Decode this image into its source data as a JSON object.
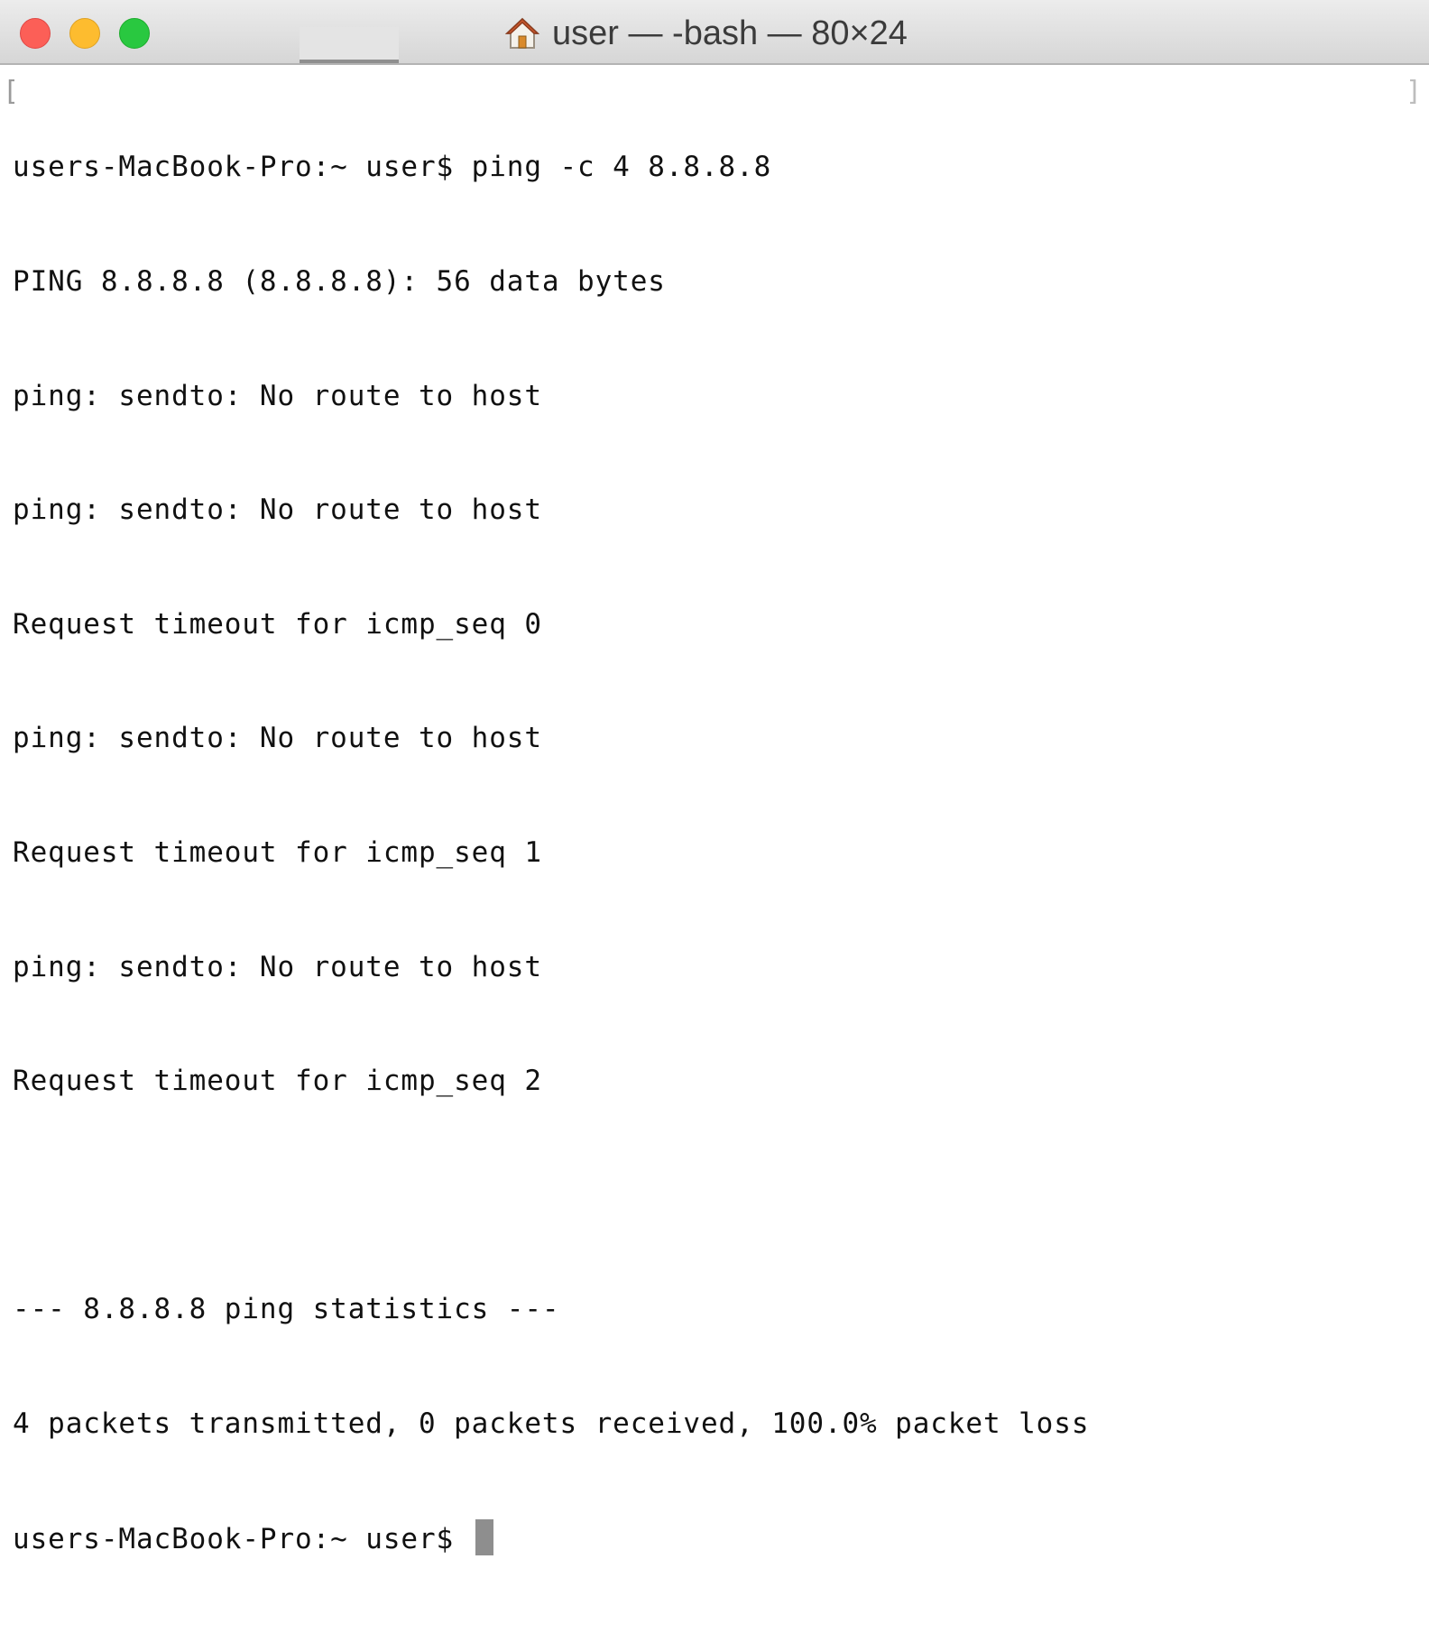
{
  "window": {
    "title": "user — -bash — 80×24",
    "traffic_lights": [
      "close",
      "minimize",
      "zoom"
    ],
    "colors": {
      "close": "#fc5f57",
      "minimize": "#fdbc2f",
      "zoom": "#29c840"
    }
  },
  "terminal": {
    "lines": [
      "users-MacBook-Pro:~ user$ ping -c 4 8.8.8.8",
      "PING 8.8.8.8 (8.8.8.8): 56 data bytes",
      "ping: sendto: No route to host",
      "ping: sendto: No route to host",
      "Request timeout for icmp_seq 0",
      "ping: sendto: No route to host",
      "Request timeout for icmp_seq 1",
      "ping: sendto: No route to host",
      "Request timeout for icmp_seq 2",
      "",
      "--- 8.8.8.8 ping statistics ---",
      "4 packets transmitted, 0 packets received, 100.0% packet loss"
    ],
    "prompt": "users-MacBook-Pro:~ user$ "
  }
}
